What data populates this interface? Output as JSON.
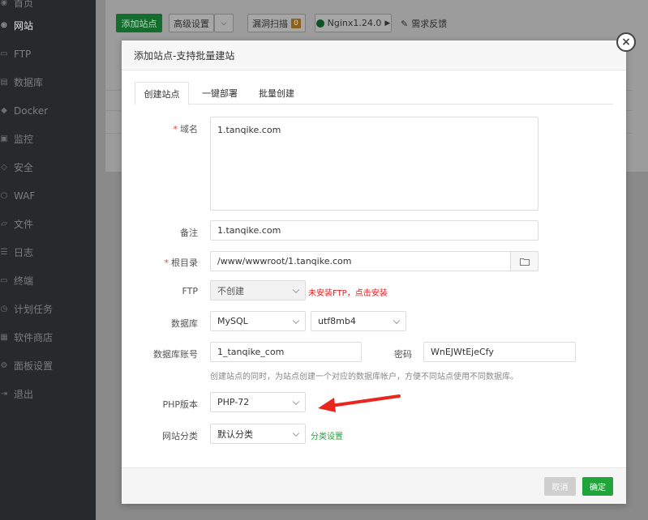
{
  "sidebar": {
    "items": [
      {
        "label": "首页",
        "icon": "home-icon"
      },
      {
        "label": "网站",
        "icon": "globe-icon",
        "active": true
      },
      {
        "label": "FTP",
        "icon": "ftp-icon"
      },
      {
        "label": "数据库",
        "icon": "database-icon"
      },
      {
        "label": "Docker",
        "icon": "docker-icon"
      },
      {
        "label": "监控",
        "icon": "monitor-icon"
      },
      {
        "label": "安全",
        "icon": "shield-icon"
      },
      {
        "label": "WAF",
        "icon": "waf-icon"
      },
      {
        "label": "文件",
        "icon": "folder-icon"
      },
      {
        "label": "日志",
        "icon": "log-icon"
      },
      {
        "label": "终端",
        "icon": "terminal-icon"
      },
      {
        "label": "计划任务",
        "icon": "clock-icon"
      },
      {
        "label": "软件商店",
        "icon": "store-icon"
      },
      {
        "label": "面板设置",
        "icon": "gear-icon"
      },
      {
        "label": "退出",
        "icon": "logout-icon"
      }
    ]
  },
  "toolbar": {
    "add_site": "添加站点",
    "advanced": "高级设置",
    "vuln_scan": "漏洞扫描",
    "vuln_count": "0",
    "nginx": "Nginx1.24.0",
    "feedback": "需求反馈"
  },
  "modal": {
    "title": "添加站点-支持批量建站",
    "close": "×",
    "tabs": [
      "创建站点",
      "一键部署",
      "批量创建"
    ],
    "form": {
      "domain_label": "域名",
      "domain_value": "1.tanqike.com",
      "remark_label": "备注",
      "remark_value": "1.tanqike.com",
      "root_label": "根目录",
      "root_value": "/www/wwwroot/1.tanqike.com",
      "ftp_label": "FTP",
      "ftp_value": "不创建",
      "ftp_hint": "未安装FTP，点击安装",
      "db_label": "数据库",
      "db_value": "MySQL",
      "db_charset": "utf8mb4",
      "db_account_label": "数据库账号",
      "db_account_value": "1_tanqike_com",
      "db_password_label": "密码",
      "db_password_value": "WnEJWtEjeCfy",
      "db_hint": "创建站点的同时，为站点创建一个对应的数据库帐户，方便不同站点使用不同数据库。",
      "php_label": "PHP版本",
      "php_value": "PHP-72",
      "category_label": "网站分类",
      "category_value": "默认分类",
      "category_link": "分类设置"
    },
    "buttons": {
      "cancel": "取消",
      "ok": "确定"
    }
  },
  "colors": {
    "accent": "#20a53a",
    "danger": "#e02020",
    "sidebar": "#262a2d",
    "arrow": "#e8261e"
  }
}
